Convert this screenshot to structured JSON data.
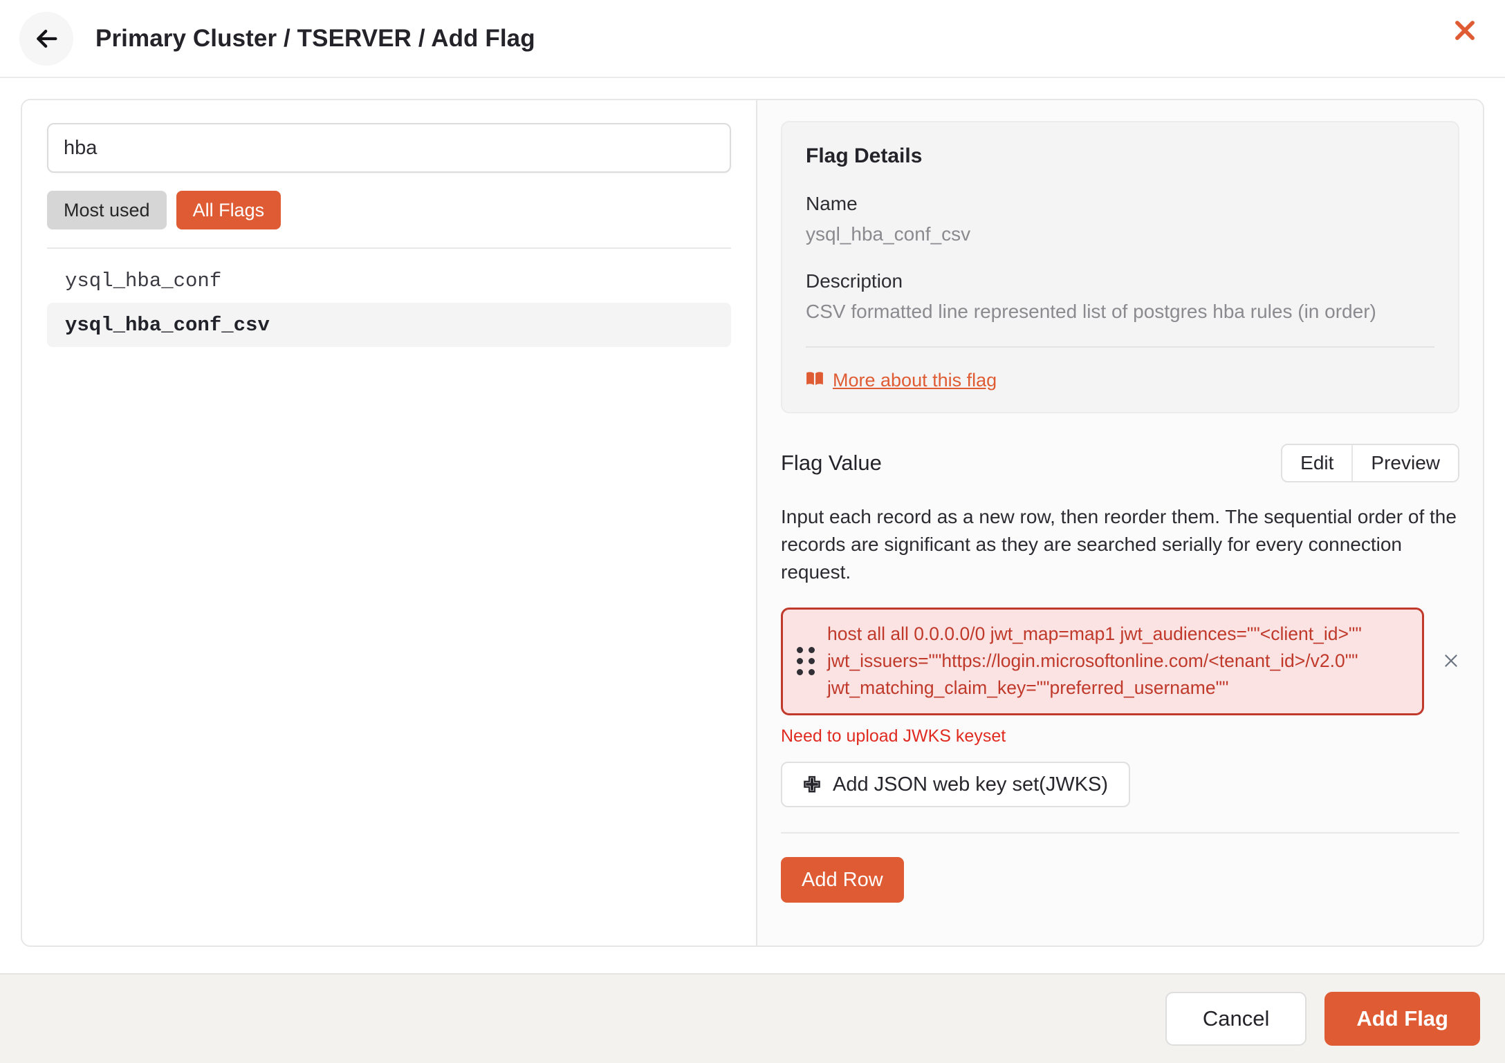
{
  "header": {
    "title": "Primary Cluster / TSERVER / Add Flag",
    "back_icon": "arrow-left-icon",
    "close_icon": "close-icon"
  },
  "search": {
    "value": "hba",
    "placeholder": "Search flags"
  },
  "filters": [
    {
      "label": "Most used",
      "active": false
    },
    {
      "label": "All Flags",
      "active": true
    }
  ],
  "flag_list": [
    {
      "name": "ysql_hba_conf",
      "selected": false
    },
    {
      "name": "ysql_hba_conf_csv",
      "selected": true
    }
  ],
  "details": {
    "title": "Flag Details",
    "name_label": "Name",
    "name_value": "ysql_hba_conf_csv",
    "description_label": "Description",
    "description_value": "CSV formatted line represented list of postgres hba rules (in order)",
    "more_link": "More about this flag",
    "more_link_icon": "book-icon"
  },
  "flag_value": {
    "title": "Flag Value",
    "modes": [
      {
        "label": "Edit",
        "selected": true
      },
      {
        "label": "Preview",
        "selected": false
      }
    ],
    "hint": "Input each record as a new row, then reorder them. The sequential order of the records are significant as they are searched serially for every connection request.",
    "rows": [
      {
        "text": "host all all 0.0.0.0/0 jwt_map=map1 jwt_audiences=\"\"<client_id>\"\" jwt_issuers=\"\"https://login.microsoftonline.com/<tenant_id>/v2.0\"\" jwt_matching_claim_key=\"\"preferred_username\"\"",
        "error": true,
        "drag_icon": "drag-handle-icon",
        "remove_icon": "remove-icon"
      }
    ],
    "error_message": "Need to upload JWKS keyset",
    "jwks_button": "Add JSON web key set(JWKS)",
    "jwks_icon": "plus-icon",
    "add_row_button": "Add Row"
  },
  "footer": {
    "cancel_label": "Cancel",
    "submit_label": "Add Flag"
  },
  "colors": {
    "accent": "#df5b33",
    "error_border": "#c0392b",
    "error_bg": "#fae3e2",
    "error_text": "#e02b20",
    "footer_bg": "#f4f2ee"
  }
}
